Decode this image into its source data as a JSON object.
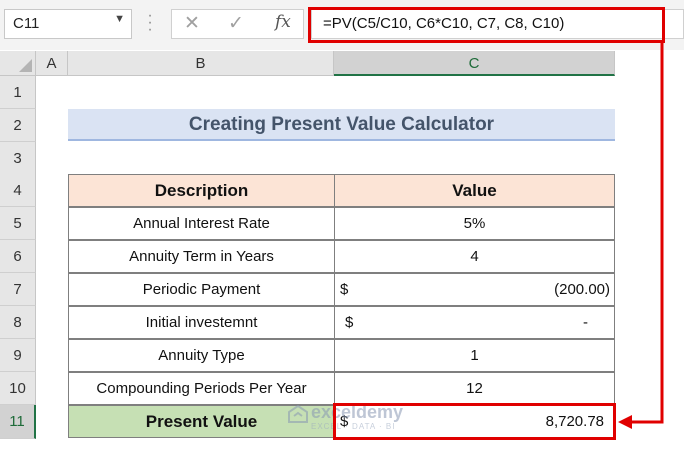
{
  "name_box": {
    "value": "C11"
  },
  "formula_bar": {
    "fx_label": "fx",
    "cancel_glyph": "✕",
    "enter_glyph": "✓",
    "formula": "=PV(C5/C10, C6*C10, C7, C8, C10)"
  },
  "columns": [
    "A",
    "B",
    "C"
  ],
  "rows": [
    "1",
    "2",
    "3",
    "4",
    "5",
    "6",
    "7",
    "8",
    "9",
    "10",
    "11"
  ],
  "sheet": {
    "title": "Creating Present Value Calculator",
    "header": {
      "description": "Description",
      "value": "Value"
    },
    "items": [
      {
        "label": "Annual Interest Rate",
        "value": "5%"
      },
      {
        "label": "Annuity Term in Years",
        "value": "4"
      },
      {
        "label": "Periodic Payment",
        "currency": "$",
        "amount": "(200.00)"
      },
      {
        "label": "Initial investemnt",
        "currency": "$",
        "amount": "-"
      },
      {
        "label": "Annuity Type",
        "value": "1"
      },
      {
        "label": "Compounding Periods Per Year",
        "value": "12"
      }
    ],
    "result": {
      "label": "Present Value",
      "currency": "$",
      "amount": "8,720.78"
    }
  },
  "watermark": {
    "name": "exceldemy",
    "tagline": "EXCEL · DATA · BI"
  },
  "colors": {
    "title_fill": "#dae3f3",
    "header_fill": "#fce4d6",
    "result_fill": "#c6e0b4",
    "highlight": "#e00000",
    "selection": "#217346"
  }
}
